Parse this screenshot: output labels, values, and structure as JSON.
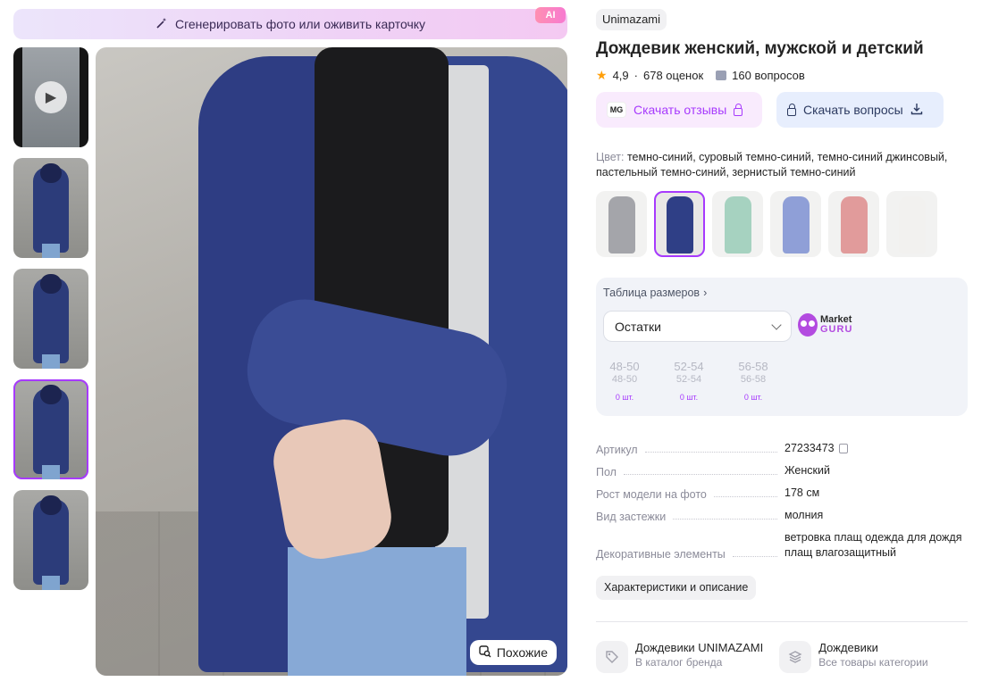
{
  "ai_banner": {
    "label": "Сгенерировать фото или оживить карточку",
    "badge": "AI"
  },
  "gallery": {
    "thumbnails": [
      {
        "kind": "video"
      },
      {
        "kind": "photo"
      },
      {
        "kind": "photo"
      },
      {
        "kind": "photo",
        "selected": true
      },
      {
        "kind": "photo"
      }
    ],
    "similar_label": "Похожие"
  },
  "product": {
    "brand": "Unimazami",
    "title": "Дождевик женский, мужской и детский",
    "rating": "4,9",
    "reviews_count": "678 оценок",
    "questions_count": "160 вопросов",
    "download_reviews": "Скачать отзывы",
    "download_reviews_logo": "MG",
    "download_questions": "Скачать вопросы",
    "color_label": "Цвет:",
    "color_value": "темно-синий, суровый темно-синий, темно-синий джинсовый, пастельный темно-синий, зернистый темно-синий",
    "swatches": [
      {
        "color": "#5a5d66"
      },
      {
        "color": "#2f3f86",
        "selected": true
      },
      {
        "color": "#5fae8e"
      },
      {
        "color": "#3552b8"
      },
      {
        "color": "#c94a4a"
      },
      {
        "color": "#e9e7e2"
      }
    ]
  },
  "sizes": {
    "table_link": "Таблица размеров",
    "stock_select": "Остатки",
    "marketguru_line1": "Market",
    "marketguru_line2": "GURU",
    "items": [
      {
        "size": "48-50",
        "ru": "48-50",
        "stock": "0 шт."
      },
      {
        "size": "52-54",
        "ru": "52-54",
        "stock": "0 шт."
      },
      {
        "size": "56-58",
        "ru": "56-58",
        "stock": "0 шт."
      }
    ]
  },
  "params": [
    {
      "key": "Артикул",
      "value": "27233473"
    },
    {
      "key": "Пол",
      "value": "Женский"
    },
    {
      "key": "Рост модели на фото",
      "value": "178 см"
    },
    {
      "key": "Вид застежки",
      "value": "молния"
    },
    {
      "key": "Декоративные элементы",
      "value": "ветровка плащ одежда для дождя плащ влагозащитный"
    }
  ],
  "characteristics_button": "Характеристики и описание",
  "links": [
    {
      "title": "Дождевики UNIMAZAMI",
      "subtitle": "В каталог бренда"
    },
    {
      "title": "Дождевики",
      "subtitle": "Все товары категории"
    }
  ],
  "colors": {
    "accent": "#a73afd",
    "star": "#ff9f0a"
  }
}
